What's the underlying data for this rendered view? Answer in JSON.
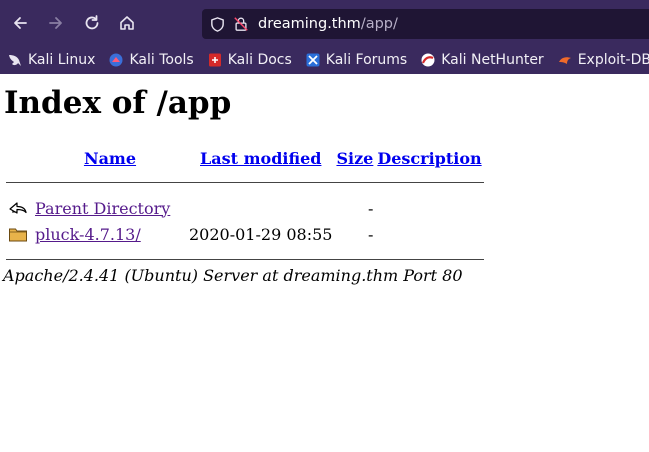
{
  "browser": {
    "url_host": "dreaming.thm",
    "url_path": "/app/",
    "bookmarks": [
      {
        "label": "Kali Linux",
        "icon": "kali-dragon-icon"
      },
      {
        "label": "Kali Tools",
        "icon": "kali-tools-icon"
      },
      {
        "label": "Kali Docs",
        "icon": "kali-docs-icon"
      },
      {
        "label": "Kali Forums",
        "icon": "kali-forums-icon"
      },
      {
        "label": "Kali NetHunter",
        "icon": "nethunter-icon"
      },
      {
        "label": "Exploit-DB",
        "icon": "exploit-db-icon"
      }
    ]
  },
  "page": {
    "title": "Index of /app",
    "columns": {
      "name": "Name",
      "last_modified": "Last modified",
      "size": "Size",
      "description": "Description"
    },
    "rows": [
      {
        "name": "Parent Directory",
        "last_modified": "",
        "size": "-",
        "description": "",
        "icon": "back-arrow-icon"
      },
      {
        "name": "pluck-4.7.13/",
        "last_modified": "2020-01-29 08:55",
        "size": "-",
        "description": "",
        "icon": "folder-icon"
      }
    ],
    "footer": "Apache/2.4.41 (Ubuntu) Server at dreaming.thm Port 80"
  },
  "colors": {
    "chrome": "#3a2a5e",
    "urlbar": "#1f1534",
    "link": "#0000ee",
    "visited": "#551a8b"
  }
}
